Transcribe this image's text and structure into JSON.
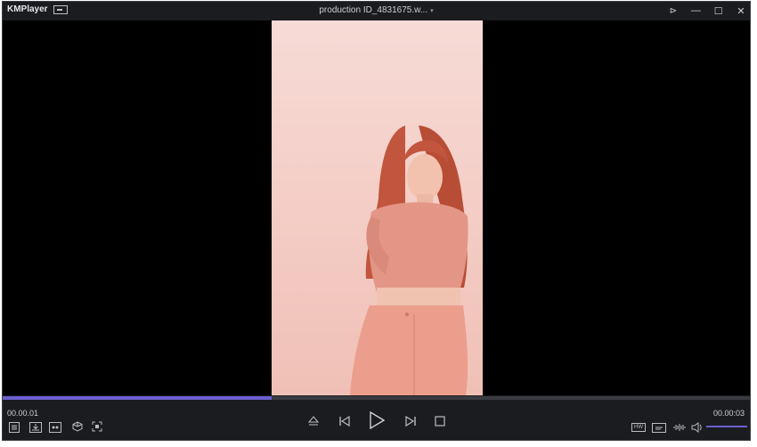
{
  "app": {
    "title": "KMPlayer"
  },
  "file": {
    "title": "production ID_4831675.w..."
  },
  "playback": {
    "current_time": "00.00.01",
    "total_time": "00.00:03",
    "progress_fraction": 0.36,
    "volume_fraction": 1.0
  },
  "toolbar_left": [
    {
      "name": "playlist-icon"
    },
    {
      "name": "download-icon"
    },
    {
      "name": "vr-icon"
    },
    {
      "name": "3d-cube-icon"
    },
    {
      "name": "capture-icon"
    }
  ],
  "toolbar_center": [
    {
      "name": "eject-icon"
    },
    {
      "name": "previous-icon"
    },
    {
      "name": "play-icon"
    },
    {
      "name": "next-icon"
    },
    {
      "name": "stop-icon"
    }
  ],
  "toolbar_right": [
    {
      "name": "hw-badge",
      "label": "HW"
    },
    {
      "name": "subtitle-icon"
    },
    {
      "name": "audio-icon"
    },
    {
      "name": "speaker-icon"
    }
  ],
  "colors": {
    "accent": "#6b5fd0",
    "background": "#1b1c20",
    "video_bg": "#000000"
  }
}
